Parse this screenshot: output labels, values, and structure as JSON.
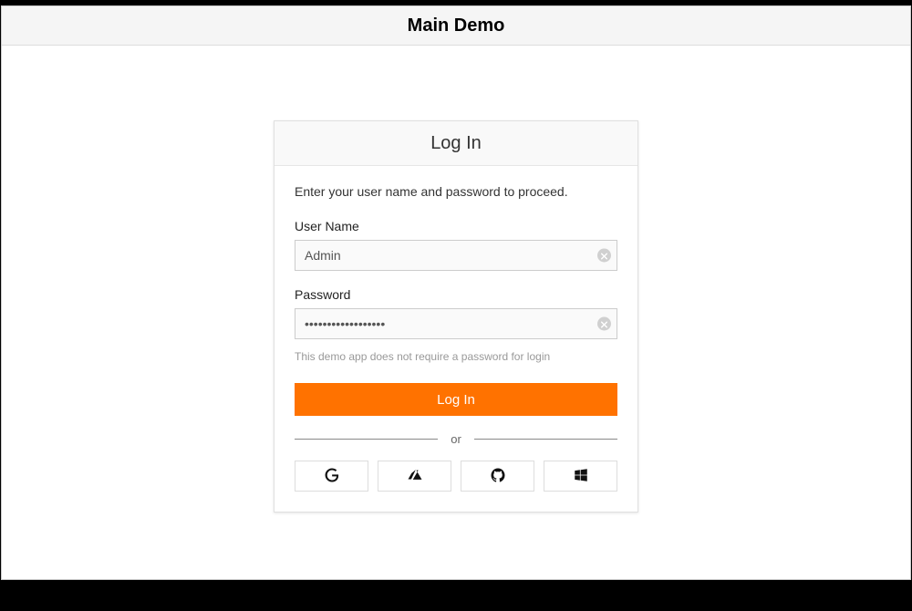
{
  "header": {
    "title": "Main Demo"
  },
  "login": {
    "card_title": "Log In",
    "instruction": "Enter your user name and password to proceed.",
    "username_label": "User Name",
    "username_value": "Admin",
    "password_label": "Password",
    "password_value": "••••••••••••••••••",
    "hint": "This demo app does not require a password for login",
    "submit_label": "Log In",
    "separator_label": "or",
    "oauth": {
      "google": "google",
      "azure": "azure",
      "github": "github",
      "windows": "windows"
    }
  }
}
